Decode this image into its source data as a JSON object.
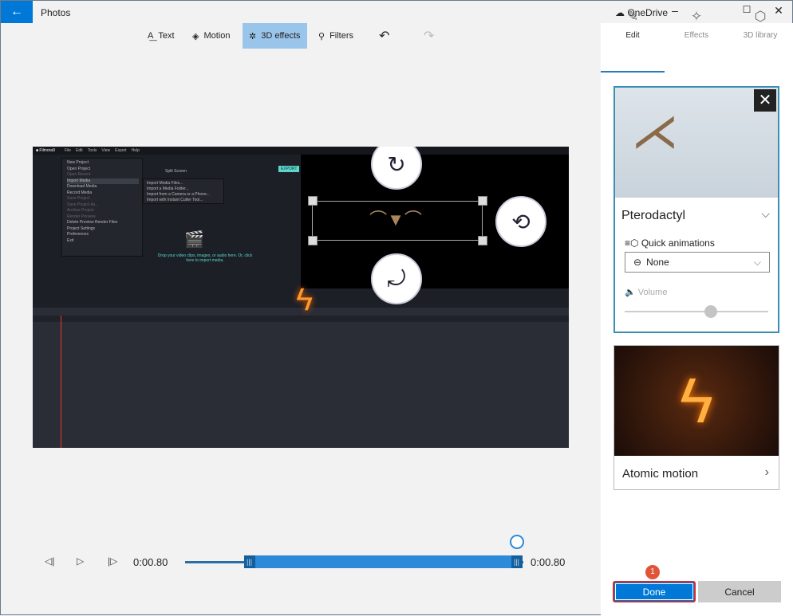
{
  "app": {
    "title": "Photos",
    "onedrive": "OneDrive"
  },
  "toolbar": {
    "text": "Text",
    "motion": "Motion",
    "effects3d": "3D effects",
    "filters": "Filters"
  },
  "panel": {
    "tabs": [
      {
        "label": "Edit"
      },
      {
        "label": "Effects"
      },
      {
        "label": "3D library"
      }
    ],
    "model": {
      "name": "Pterodactyl",
      "quick_animations_label": "Quick animations",
      "animation_value": "None",
      "volume_label": "Volume",
      "volume_level": 0.6
    },
    "effect": {
      "name": "Atomic motion"
    },
    "done": "Done",
    "cancel": "Cancel",
    "badge": "1"
  },
  "video": {
    "menu": [
      "File",
      "Edit",
      "Tools",
      "View",
      "Export",
      "Help"
    ],
    "file_menu": [
      "New Project",
      "Open Project",
      "Open Recent",
      "Import Media",
      "Download Media",
      "Record Media",
      "Save Project",
      "Save Project As...",
      "Archive Project",
      "Render Preview",
      "Delete Preview Render Files",
      "Project Settings",
      "Preferences",
      "Exit"
    ],
    "import_submenu": [
      "Import Media Files...",
      "Import a Media Folder...",
      "Import from a Camera or a Phone...",
      "Import with Instant Cutter Tool..."
    ],
    "export": "EXPORT",
    "split_screen": "Split Screen",
    "drop_hint": "Drop your video clips, images, or audio here. Or, click here to import media."
  },
  "playback": {
    "start_time": "0:00.80",
    "end_time": "0:00.80",
    "trim_start": 0.19,
    "trim_end": 0.98,
    "playhead": 0.98
  }
}
